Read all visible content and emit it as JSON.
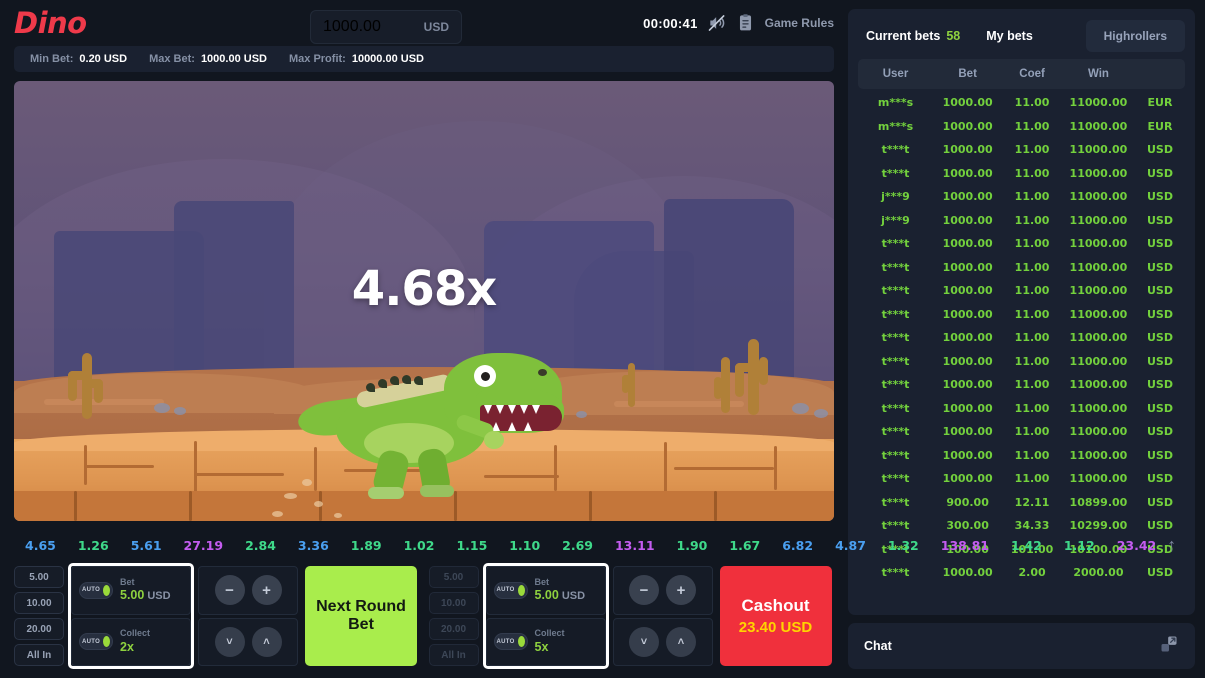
{
  "header": {
    "logo": "Dino",
    "balance_value": "1000.00",
    "balance_currency": "USD",
    "timer": "00:00:41",
    "sound_icon": "sound-muted-icon",
    "rules_icon": "clipboard-icon",
    "game_rules": "Game Rules"
  },
  "limits": {
    "min_bet_label": "Min Bet:",
    "min_bet_value": "0.20 USD",
    "max_bet_label": "Max Bet:",
    "max_bet_value": "1000.00 USD",
    "max_profit_label": "Max Profit:",
    "max_profit_value": "10000.00 USD"
  },
  "scene": {
    "multiplier": "4.68x"
  },
  "history": {
    "items": [
      {
        "value": "4.65",
        "color": "#4a9ff0"
      },
      {
        "value": "1.26",
        "color": "#3fd98a"
      },
      {
        "value": "5.61",
        "color": "#4a9ff0"
      },
      {
        "value": "27.19",
        "color": "#c45cf0"
      },
      {
        "value": "2.84",
        "color": "#3fd98a"
      },
      {
        "value": "3.36",
        "color": "#4a9ff0"
      },
      {
        "value": "1.89",
        "color": "#3fd98a"
      },
      {
        "value": "1.02",
        "color": "#3fd98a"
      },
      {
        "value": "1.15",
        "color": "#3fd98a"
      },
      {
        "value": "1.10",
        "color": "#3fd98a"
      },
      {
        "value": "2.69",
        "color": "#3fd98a"
      },
      {
        "value": "13.11",
        "color": "#c45cf0"
      },
      {
        "value": "1.90",
        "color": "#3fd98a"
      },
      {
        "value": "1.67",
        "color": "#3fd98a"
      },
      {
        "value": "6.82",
        "color": "#4a9ff0"
      },
      {
        "value": "4.87",
        "color": "#4a9ff0"
      },
      {
        "value": "1.32",
        "color": "#3fd98a"
      },
      {
        "value": "138.81",
        "color": "#c45cf0"
      },
      {
        "value": "1.42",
        "color": "#3fd98a"
      },
      {
        "value": "1.12",
        "color": "#3fd98a"
      },
      {
        "value": "23.42",
        "color": "#c45cf0"
      }
    ],
    "expand_icon": "arrow-up-icon"
  },
  "bet_panel_left": {
    "quick_bets": [
      "5.00",
      "10.00",
      "20.00",
      "All In"
    ],
    "bet_label": "Bet",
    "bet_value": "5.00",
    "bet_currency": "USD",
    "collect_label": "Collect",
    "collect_value": "2x",
    "auto_label": "AUTO",
    "minus": "−",
    "plus": "+",
    "down": "˅",
    "up": "˄",
    "action_label": "Next Round Bet"
  },
  "bet_panel_right": {
    "quick_bets": [
      "5.00",
      "10.00",
      "20.00",
      "All In"
    ],
    "bet_label": "Bet",
    "bet_value": "5.00",
    "bet_currency": "USD",
    "collect_label": "Collect",
    "collect_value": "5x",
    "auto_label": "AUTO",
    "minus": "−",
    "plus": "+",
    "down": "˅",
    "up": "˄",
    "action_label": "Cashout",
    "action_amount": "23.40",
    "action_currency": "USD"
  },
  "bets_panel": {
    "tab_current": "Current bets",
    "current_count": "58",
    "tab_mine": "My bets",
    "highrollers": "Highrollers",
    "columns": [
      "User",
      "Bet",
      "Coef",
      "Win",
      ""
    ],
    "rows": [
      {
        "user": "m***s",
        "bet": "1000.00",
        "coef": "11.00",
        "win": "11000.00",
        "cur": "EUR"
      },
      {
        "user": "m***s",
        "bet": "1000.00",
        "coef": "11.00",
        "win": "11000.00",
        "cur": "EUR"
      },
      {
        "user": "t***t",
        "bet": "1000.00",
        "coef": "11.00",
        "win": "11000.00",
        "cur": "USD"
      },
      {
        "user": "t***t",
        "bet": "1000.00",
        "coef": "11.00",
        "win": "11000.00",
        "cur": "USD"
      },
      {
        "user": "j***9",
        "bet": "1000.00",
        "coef": "11.00",
        "win": "11000.00",
        "cur": "USD"
      },
      {
        "user": "j***9",
        "bet": "1000.00",
        "coef": "11.00",
        "win": "11000.00",
        "cur": "USD"
      },
      {
        "user": "t***t",
        "bet": "1000.00",
        "coef": "11.00",
        "win": "11000.00",
        "cur": "USD"
      },
      {
        "user": "t***t",
        "bet": "1000.00",
        "coef": "11.00",
        "win": "11000.00",
        "cur": "USD"
      },
      {
        "user": "t***t",
        "bet": "1000.00",
        "coef": "11.00",
        "win": "11000.00",
        "cur": "USD"
      },
      {
        "user": "t***t",
        "bet": "1000.00",
        "coef": "11.00",
        "win": "11000.00",
        "cur": "USD"
      },
      {
        "user": "t***t",
        "bet": "1000.00",
        "coef": "11.00",
        "win": "11000.00",
        "cur": "USD"
      },
      {
        "user": "t***t",
        "bet": "1000.00",
        "coef": "11.00",
        "win": "11000.00",
        "cur": "USD"
      },
      {
        "user": "t***t",
        "bet": "1000.00",
        "coef": "11.00",
        "win": "11000.00",
        "cur": "USD"
      },
      {
        "user": "t***t",
        "bet": "1000.00",
        "coef": "11.00",
        "win": "11000.00",
        "cur": "USD"
      },
      {
        "user": "t***t",
        "bet": "1000.00",
        "coef": "11.00",
        "win": "11000.00",
        "cur": "USD"
      },
      {
        "user": "t***t",
        "bet": "1000.00",
        "coef": "11.00",
        "win": "11000.00",
        "cur": "USD"
      },
      {
        "user": "t***t",
        "bet": "1000.00",
        "coef": "11.00",
        "win": "11000.00",
        "cur": "USD"
      },
      {
        "user": "t***t",
        "bet": "900.00",
        "coef": "12.11",
        "win": "10899.00",
        "cur": "USD"
      },
      {
        "user": "t***t",
        "bet": "300.00",
        "coef": "34.33",
        "win": "10299.00",
        "cur": "USD"
      },
      {
        "user": "t***t",
        "bet": "100.00",
        "coef": "101.00",
        "win": "10100.00",
        "cur": "USD"
      },
      {
        "user": "t***t",
        "bet": "1000.00",
        "coef": "2.00",
        "win": "2000.00",
        "cur": "USD"
      }
    ]
  },
  "chat": {
    "label": "Chat",
    "expand_icon": "expand-icon"
  }
}
